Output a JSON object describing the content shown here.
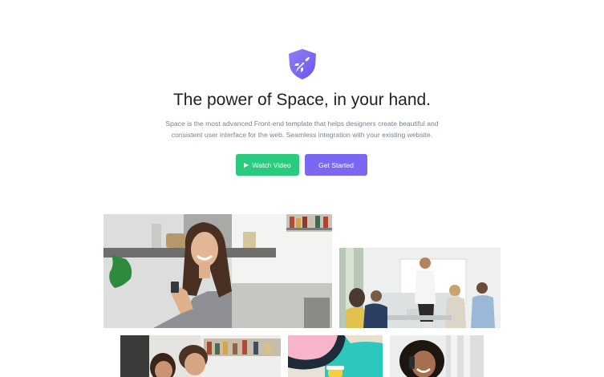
{
  "hero": {
    "logo_icon": "rocket-shield-icon",
    "title": "The power of Space, in your hand.",
    "description_line1": "Space is the most advanced Front-end template that helps designers create beautiful and",
    "description_line2": "consistent user interface for the web. Seamless integration with your existing website.",
    "watch_video_label": "Watch Video",
    "get_started_label": "Get Started"
  },
  "colors": {
    "primary": "#7a67f2",
    "success": "#2bcb7f",
    "heading": "#1e2022",
    "body_text": "#77838f"
  },
  "gallery": [
    "woman-smiling-with-phone-photo",
    "office-meeting-photo",
    "couple-with-laptop-photo",
    "colorful-wall-photo",
    "woman-on-phone-photo"
  ]
}
